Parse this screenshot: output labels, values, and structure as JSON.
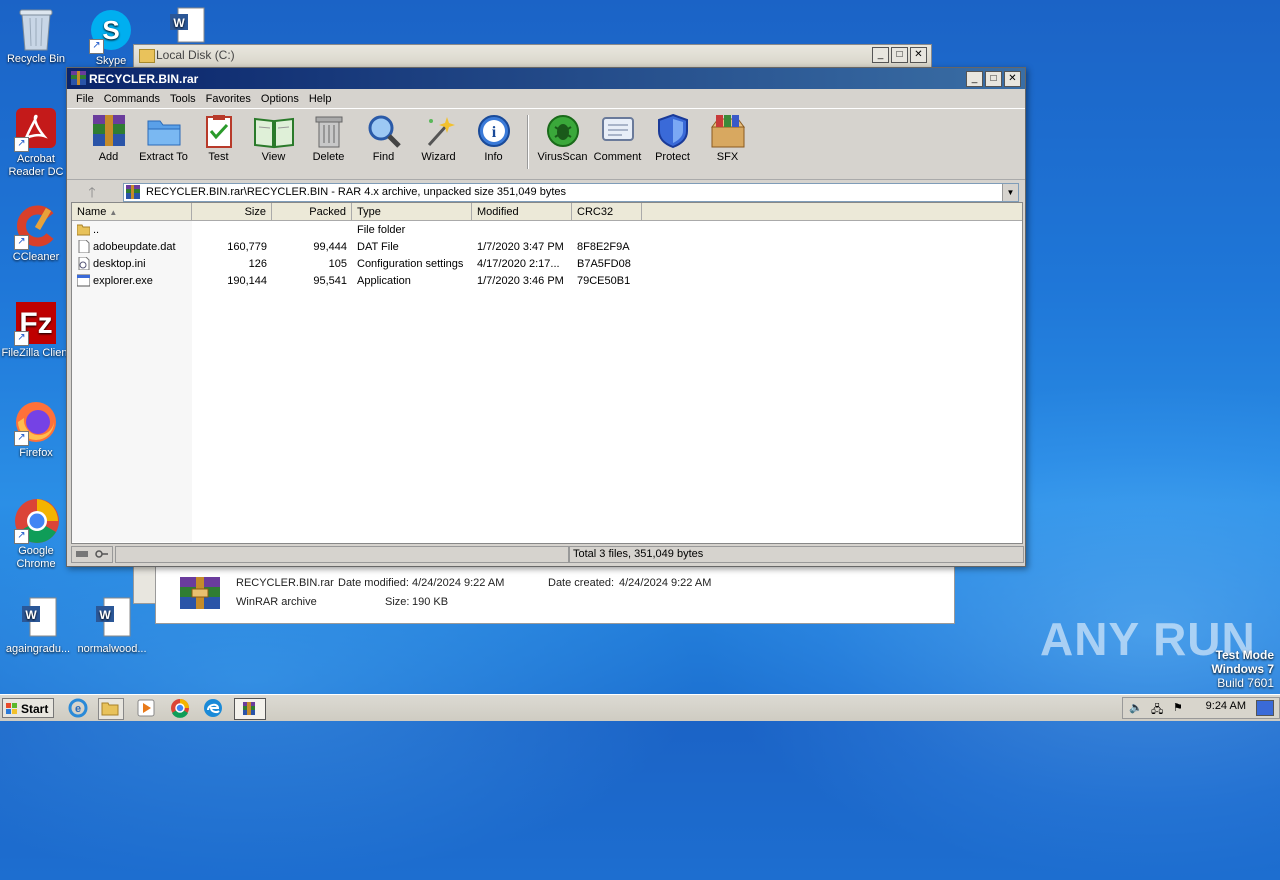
{
  "desktop": {
    "icons": [
      {
        "id": "recycle",
        "label": "Recycle Bin"
      },
      {
        "id": "skype",
        "label": "Skype"
      },
      {
        "id": "acrobat",
        "label": "Acrobat Reader DC"
      },
      {
        "id": "ccleaner",
        "label": "CCleaner"
      },
      {
        "id": "filezilla",
        "label": "FileZilla Client"
      },
      {
        "id": "firefox",
        "label": "Firefox"
      },
      {
        "id": "chrome",
        "label": "Google Chrome"
      },
      {
        "id": "doc1",
        "label": "againgradu..."
      },
      {
        "id": "doc2",
        "label": "normalwood..."
      }
    ]
  },
  "explorer": {
    "title": "Local Disk (C:)",
    "details": {
      "filename": "RECYCLER.BIN.rar",
      "modified_label": "Date modified:",
      "modified": "4/24/2024 9:22 AM",
      "created_label": "Date created:",
      "created": "4/24/2024 9:22 AM",
      "kind": "WinRAR archive",
      "size_label": "Size:",
      "size": "190 KB"
    }
  },
  "winrar": {
    "title": "RECYCLER.BIN.rar",
    "menu": [
      "File",
      "Commands",
      "Tools",
      "Favorites",
      "Options",
      "Help"
    ],
    "toolbar": [
      "Add",
      "Extract To",
      "Test",
      "View",
      "Delete",
      "Find",
      "Wizard",
      "Info",
      "VirusScan",
      "Comment",
      "Protect",
      "SFX"
    ],
    "address": "RECYCLER.BIN.rar\\RECYCLER.BIN - RAR 4.x archive, unpacked size 351,049 bytes",
    "columns": [
      "Name",
      "Size",
      "Packed",
      "Type",
      "Modified",
      "CRC32"
    ],
    "rows": [
      {
        "name": "..",
        "size": "",
        "packed": "",
        "type": "File folder",
        "modified": "",
        "crc": ""
      },
      {
        "name": "adobeupdate.dat",
        "size": "160,779",
        "packed": "99,444",
        "type": "DAT File",
        "modified": "1/7/2020 3:47 PM",
        "crc": "8F8E2F9A"
      },
      {
        "name": "desktop.ini",
        "size": "126",
        "packed": "105",
        "type": "Configuration settings",
        "modified": "4/17/2020 2:17...",
        "crc": "B7A5FD08"
      },
      {
        "name": "explorer.exe",
        "size": "190,144",
        "packed": "95,541",
        "type": "Application",
        "modified": "1/7/2020 3:46 PM",
        "crc": "79CE50B1"
      }
    ],
    "status": "Total 3 files, 351,049 bytes"
  },
  "watermark": {
    "brand": "ANY RUN",
    "line1": "Test Mode",
    "line2": "Windows 7",
    "line3": "Build 7601"
  },
  "taskbar": {
    "start": "Start",
    "clock": "9:24 AM"
  }
}
